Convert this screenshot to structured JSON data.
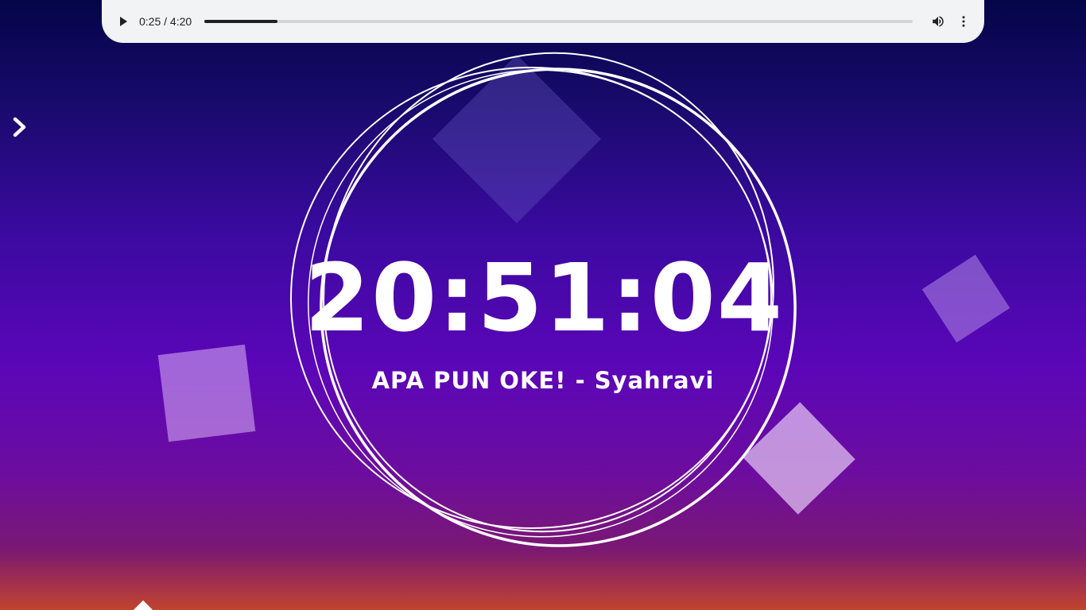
{
  "audio_player": {
    "current_time": "0:25",
    "separator": " / ",
    "duration": "4:20",
    "progress_fraction": 0.103,
    "play_icon": "play-icon",
    "volume_icon": "volume-icon",
    "menu_icon": "more-vert-icon"
  },
  "nav": {
    "icon": "chevron-right-icon"
  },
  "clock": {
    "time": "20:51:04"
  },
  "song": {
    "title": "APA PUN OKE! - Syahravi"
  },
  "colors": {
    "player_bg": "#f1f3f4",
    "text": "#ffffff",
    "bg_top": "#040548",
    "bg_mid": "#5b06b8",
    "bg_bottom": "#c1442e"
  }
}
